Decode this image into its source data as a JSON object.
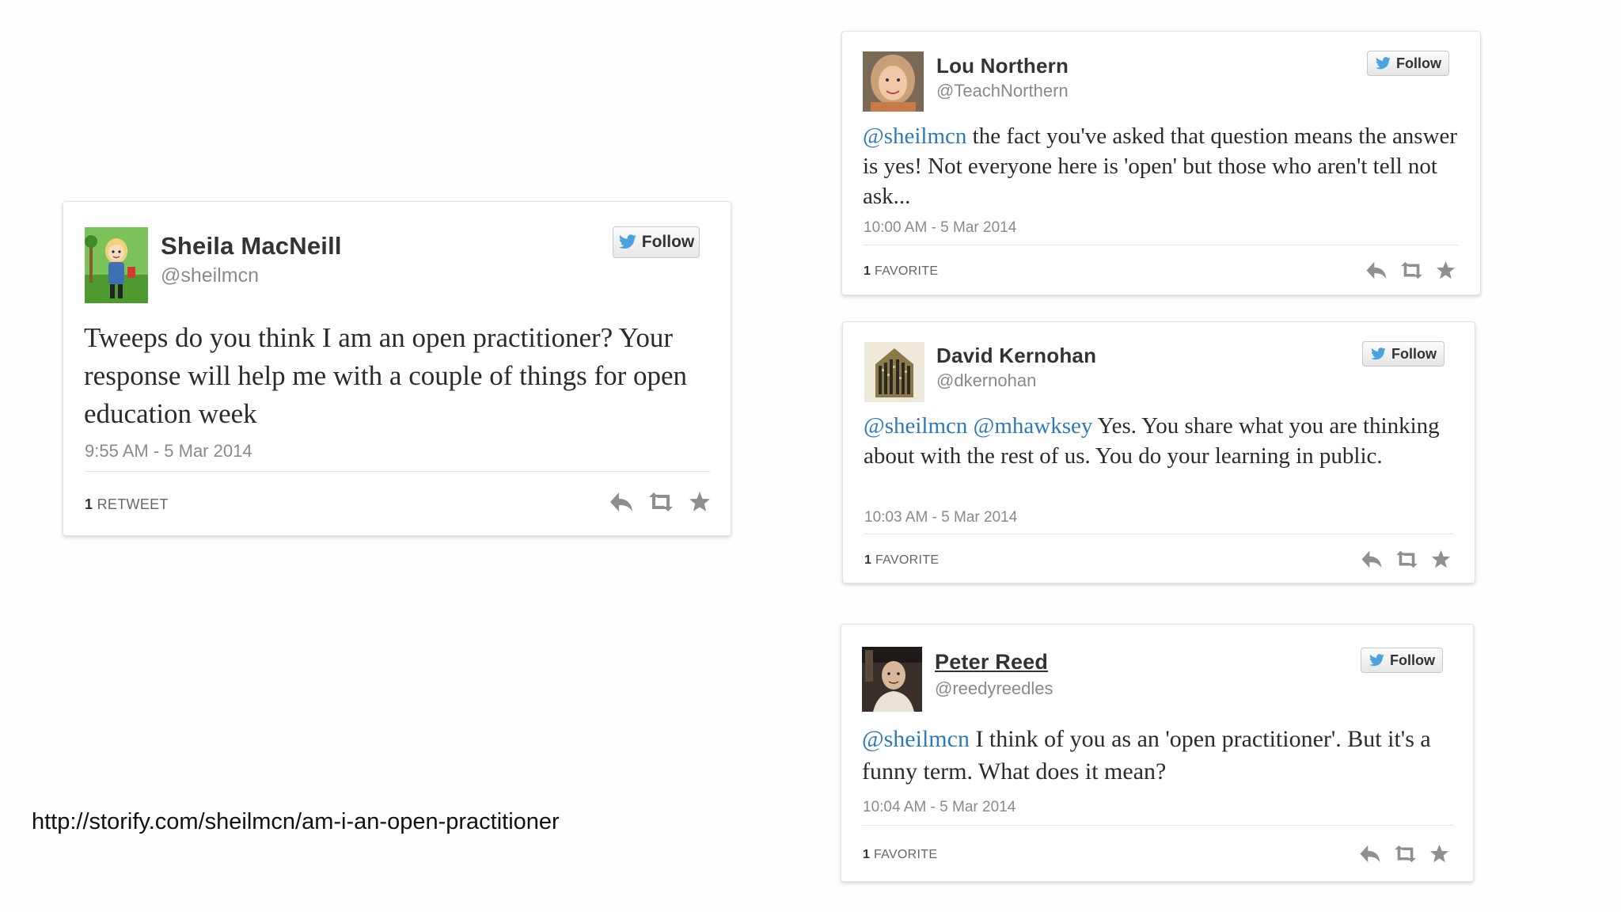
{
  "tweets": [
    {
      "name": "Sheila MacNeill",
      "handle": "@sheilmcn",
      "follow_label": "Follow",
      "mentions": [],
      "text": "Tweeps do you think I am an open practitioner? Your response will help me with a couple of things for open education week",
      "timestamp": "9:55 AM - 5 Mar 2014",
      "stat_count": "1",
      "stat_label": "RETWEET",
      "avatar_icon": "cartoon-avatar-icon",
      "avatar_bg": "#5aa83c"
    },
    {
      "name": "Lou Northern",
      "handle": "@TeachNorthern",
      "follow_label": "Follow",
      "mentions": [
        "@sheilmcn"
      ],
      "text": "the fact you've asked that question means the answer is yes!  Not everyone here is 'open' but those who aren't tell not ask...",
      "timestamp": "10:00 AM - 5 Mar 2014",
      "stat_count": "1",
      "stat_label": "FAVORITE",
      "avatar_icon": "portrait-photo-icon",
      "avatar_bg": "#b58868"
    },
    {
      "name": "David Kernohan",
      "handle": "@dkernohan",
      "follow_label": "Follow",
      "mentions": [
        "@sheilmcn",
        "@mhawksey"
      ],
      "text": "Yes. You share what you are thinking about with the rest of us. You do your learning in public.",
      "timestamp": "10:03 AM - 5 Mar 2014",
      "stat_count": "1",
      "stat_label": "FAVORITE",
      "avatar_icon": "building-icon",
      "avatar_bg": "#efe9dc"
    },
    {
      "name": "Peter Reed",
      "handle": "@reedyreedles",
      "follow_label": "Follow",
      "mentions": [
        "@sheilmcn"
      ],
      "text": "I think of you as an 'open practitioner'. But it's a funny term. What does it mean?",
      "timestamp": "10:04 AM - 5 Mar 2014",
      "stat_count": "1",
      "stat_label": "FAVORITE",
      "avatar_icon": "portrait-photo-icon",
      "avatar_bg": "#3a302a"
    }
  ],
  "source_link": "http://storify.com/sheilmcn/am-i-an-open-practitioner",
  "colors": {
    "mention": "#2b7bb9",
    "twitter_bird": "#4aa3df",
    "action_icon": "#8f8f8f"
  },
  "icons": {
    "follow": "twitter-bird-icon",
    "reply": "reply-icon",
    "retweet": "retweet-icon",
    "favorite": "star-icon"
  }
}
